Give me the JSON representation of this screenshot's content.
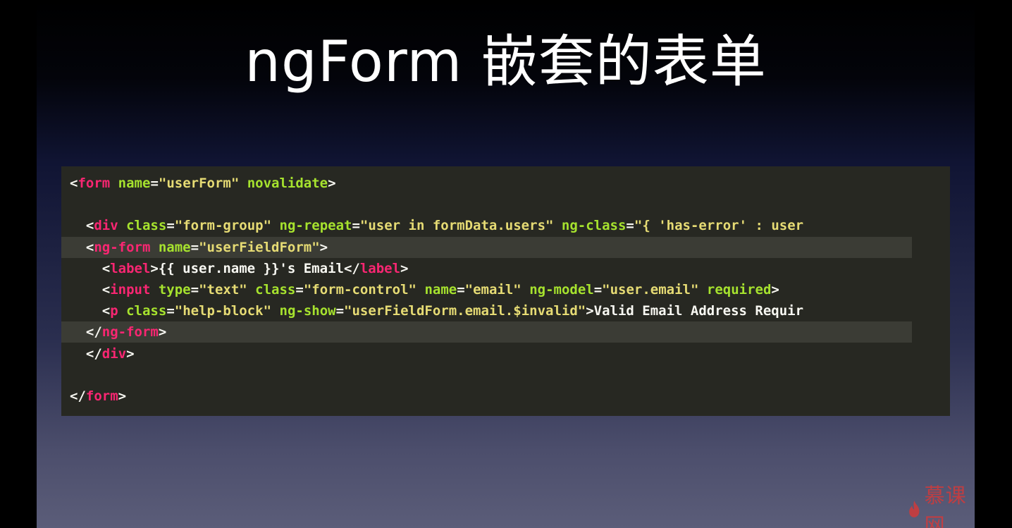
{
  "slide": {
    "title": "ngForm 嵌套的表单",
    "watermark": "慕课网"
  },
  "colors": {
    "tag": "#f92672",
    "attribute": "#a6e22e",
    "string": "#e6db74",
    "text": "#f8f8f2",
    "code_background": "#272822",
    "highlight": "#3b3c35"
  },
  "code": {
    "lines": [
      {
        "tokens": [
          {
            "t": "<",
            "k": "punc"
          },
          {
            "t": "form",
            "k": "tag"
          },
          {
            "t": " ",
            "k": "punc"
          },
          {
            "t": "name",
            "k": "attr"
          },
          {
            "t": "=",
            "k": "punc"
          },
          {
            "t": "\"userForm\"",
            "k": "str"
          },
          {
            "t": " ",
            "k": "punc"
          },
          {
            "t": "novalidate",
            "k": "attr"
          },
          {
            "t": ">",
            "k": "punc"
          }
        ]
      },
      {
        "tokens": []
      },
      {
        "tokens": [
          {
            "t": "  <",
            "k": "punc"
          },
          {
            "t": "div",
            "k": "tag"
          },
          {
            "t": " ",
            "k": "punc"
          },
          {
            "t": "class",
            "k": "attr"
          },
          {
            "t": "=",
            "k": "punc"
          },
          {
            "t": "\"form-group\"",
            "k": "str"
          },
          {
            "t": " ",
            "k": "punc"
          },
          {
            "t": "ng-repeat",
            "k": "attr"
          },
          {
            "t": "=",
            "k": "punc"
          },
          {
            "t": "\"user in formData.users\"",
            "k": "str"
          },
          {
            "t": " ",
            "k": "punc"
          },
          {
            "t": "ng-class",
            "k": "attr"
          },
          {
            "t": "=",
            "k": "punc"
          },
          {
            "t": "\"{ 'has-error' : user",
            "k": "str"
          }
        ]
      },
      {
        "highlight": true,
        "tokens": [
          {
            "t": "  <",
            "k": "punc"
          },
          {
            "t": "ng-form",
            "k": "tag"
          },
          {
            "t": " ",
            "k": "punc"
          },
          {
            "t": "name",
            "k": "attr"
          },
          {
            "t": "=",
            "k": "punc"
          },
          {
            "t": "\"userFieldForm\"",
            "k": "str"
          },
          {
            "t": ">",
            "k": "punc"
          }
        ]
      },
      {
        "tokens": [
          {
            "t": "    <",
            "k": "punc"
          },
          {
            "t": "label",
            "k": "tag"
          },
          {
            "t": ">{{ user.name }}'s Email</",
            "k": "text"
          },
          {
            "t": "label",
            "k": "tag"
          },
          {
            "t": ">",
            "k": "punc"
          }
        ]
      },
      {
        "tokens": [
          {
            "t": "    <",
            "k": "punc"
          },
          {
            "t": "input",
            "k": "tag"
          },
          {
            "t": " ",
            "k": "punc"
          },
          {
            "t": "type",
            "k": "attr"
          },
          {
            "t": "=",
            "k": "punc"
          },
          {
            "t": "\"text\"",
            "k": "str"
          },
          {
            "t": " ",
            "k": "punc"
          },
          {
            "t": "class",
            "k": "attr"
          },
          {
            "t": "=",
            "k": "punc"
          },
          {
            "t": "\"form-control\"",
            "k": "str"
          },
          {
            "t": " ",
            "k": "punc"
          },
          {
            "t": "name",
            "k": "attr"
          },
          {
            "t": "=",
            "k": "punc"
          },
          {
            "t": "\"email\"",
            "k": "str"
          },
          {
            "t": " ",
            "k": "punc"
          },
          {
            "t": "ng-model",
            "k": "attr"
          },
          {
            "t": "=",
            "k": "punc"
          },
          {
            "t": "\"user.email\"",
            "k": "str"
          },
          {
            "t": " ",
            "k": "punc"
          },
          {
            "t": "required",
            "k": "attr"
          },
          {
            "t": ">",
            "k": "punc"
          }
        ]
      },
      {
        "tokens": [
          {
            "t": "    <",
            "k": "punc"
          },
          {
            "t": "p",
            "k": "tag"
          },
          {
            "t": " ",
            "k": "punc"
          },
          {
            "t": "class",
            "k": "attr"
          },
          {
            "t": "=",
            "k": "punc"
          },
          {
            "t": "\"help-block\"",
            "k": "str"
          },
          {
            "t": " ",
            "k": "punc"
          },
          {
            "t": "ng-show",
            "k": "attr"
          },
          {
            "t": "=",
            "k": "punc"
          },
          {
            "t": "\"userFieldForm.email.$invalid\"",
            "k": "str"
          },
          {
            "t": ">Valid Email Address Requir",
            "k": "text"
          }
        ]
      },
      {
        "highlight": true,
        "tokens": [
          {
            "t": "  </",
            "k": "punc"
          },
          {
            "t": "ng-form",
            "k": "tag"
          },
          {
            "t": ">",
            "k": "punc"
          }
        ]
      },
      {
        "tokens": [
          {
            "t": "  </",
            "k": "punc"
          },
          {
            "t": "div",
            "k": "tag"
          },
          {
            "t": ">",
            "k": "punc"
          }
        ]
      },
      {
        "tokens": []
      },
      {
        "tokens": [
          {
            "t": "</",
            "k": "punc"
          },
          {
            "t": "form",
            "k": "tag"
          },
          {
            "t": ">",
            "k": "punc"
          }
        ]
      }
    ]
  }
}
